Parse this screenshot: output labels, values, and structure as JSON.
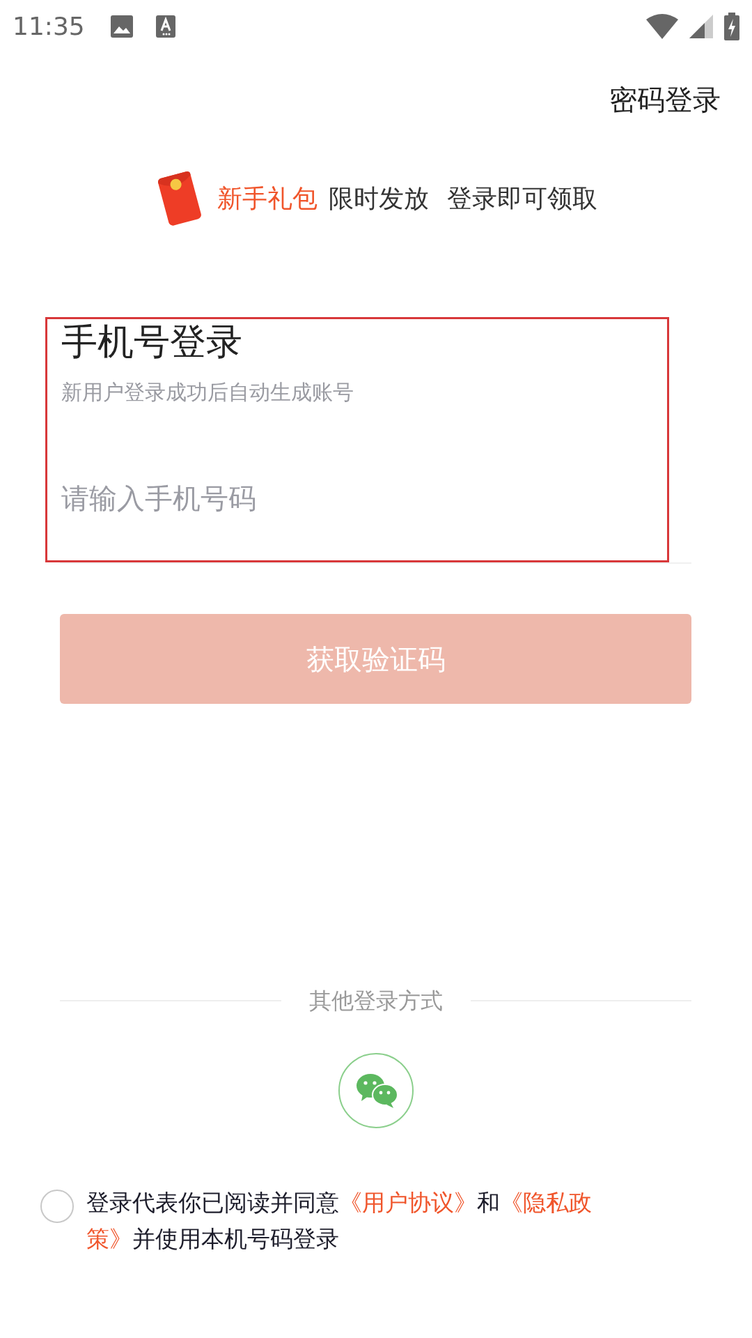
{
  "status_bar": {
    "time": "11:35"
  },
  "top_link": "密码登录",
  "banner": {
    "highlight": "新手礼包",
    "text_1": "限时发放",
    "text_2": "登录即可领取"
  },
  "login": {
    "title": "手机号登录",
    "subtitle": "新用户登录成功后自动生成账号",
    "phone_field": {
      "placeholder": "请输入手机号码"
    },
    "submit_button": "获取验证码",
    "submit_disabled": true
  },
  "other_methods": {
    "label": "其他登录方式"
  },
  "agreement": {
    "checked": false,
    "parts": [
      {
        "kind": "plain",
        "text": "登录代表你已阅读并同意"
      },
      {
        "kind": "link",
        "text": "《用户协议》"
      },
      {
        "kind": "plain",
        "text": "和"
      },
      {
        "kind": "link",
        "text": "《隐私政"
      },
      {
        "kind": "link",
        "text": "策》"
      },
      {
        "kind": "plain",
        "text": "并使用本机号码登录"
      }
    ]
  }
}
